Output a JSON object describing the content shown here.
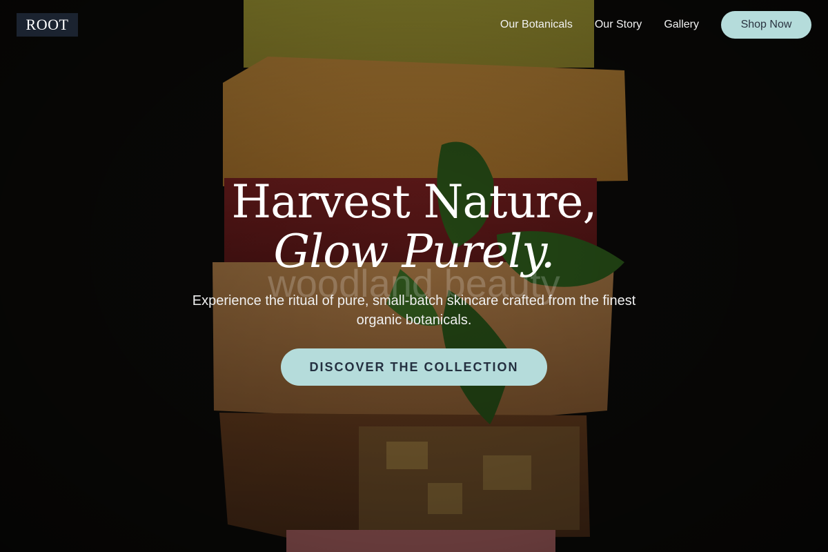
{
  "brand": {
    "logo_text": "ROOT"
  },
  "nav": {
    "links": [
      "Our Botanicals",
      "Our Story",
      "Gallery"
    ],
    "shop_label": "Shop Now"
  },
  "hero": {
    "heading_line1": "Harvest Nature,",
    "heading_line2": "Glow Purely.",
    "watermark": "woodland beauty",
    "subtitle": "Experience the ritual of pure, small-batch skincare crafted from the finest organic botanicals.",
    "cta_label": "DISCOVER THE COLLECTION"
  },
  "colors": {
    "accent": "#b5dcdb",
    "logo_bg": "#1b2330",
    "background": "#0d0d0b"
  }
}
